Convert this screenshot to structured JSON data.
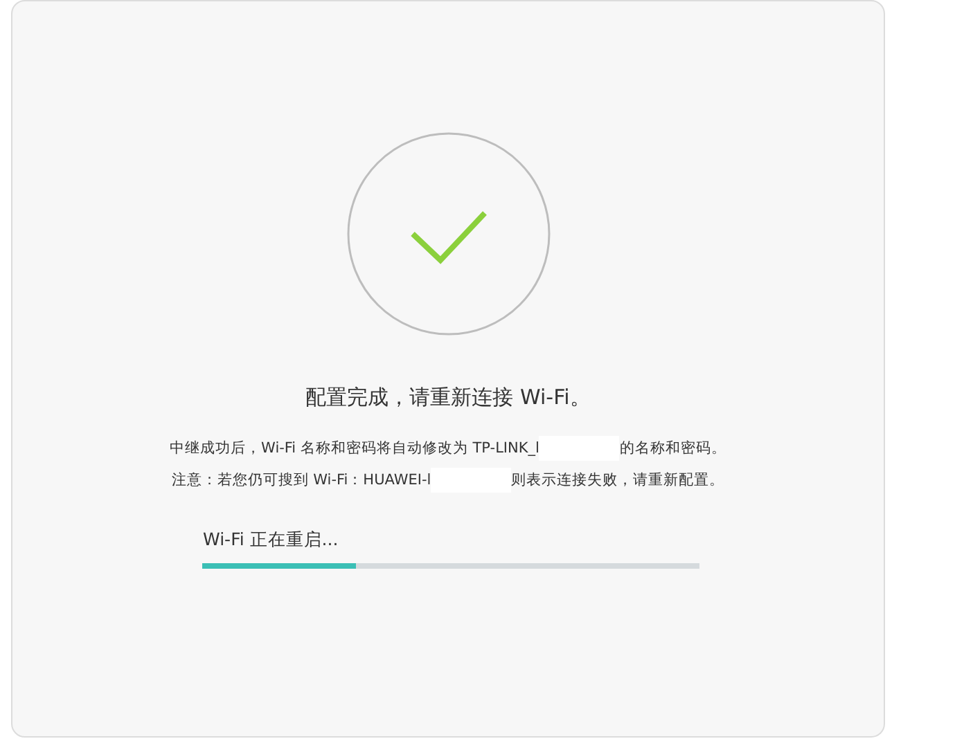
{
  "title": "配置完成，请重新连接 Wi-Fi。",
  "notes": [
    {
      "parts": [
        "中继成功后，Wi-Fi 名称和密码将自动修改为 TP-LINK_l",
        "的名称和密码。"
      ]
    },
    {
      "parts": [
        "注意：若您仍可搜到 Wi-Fi：HUAWEI-l",
        "则表示连接失败，请重新配置。"
      ]
    }
  ],
  "progress": {
    "label": "Wi-Fi 正在重启...",
    "level": 0.31
  }
}
